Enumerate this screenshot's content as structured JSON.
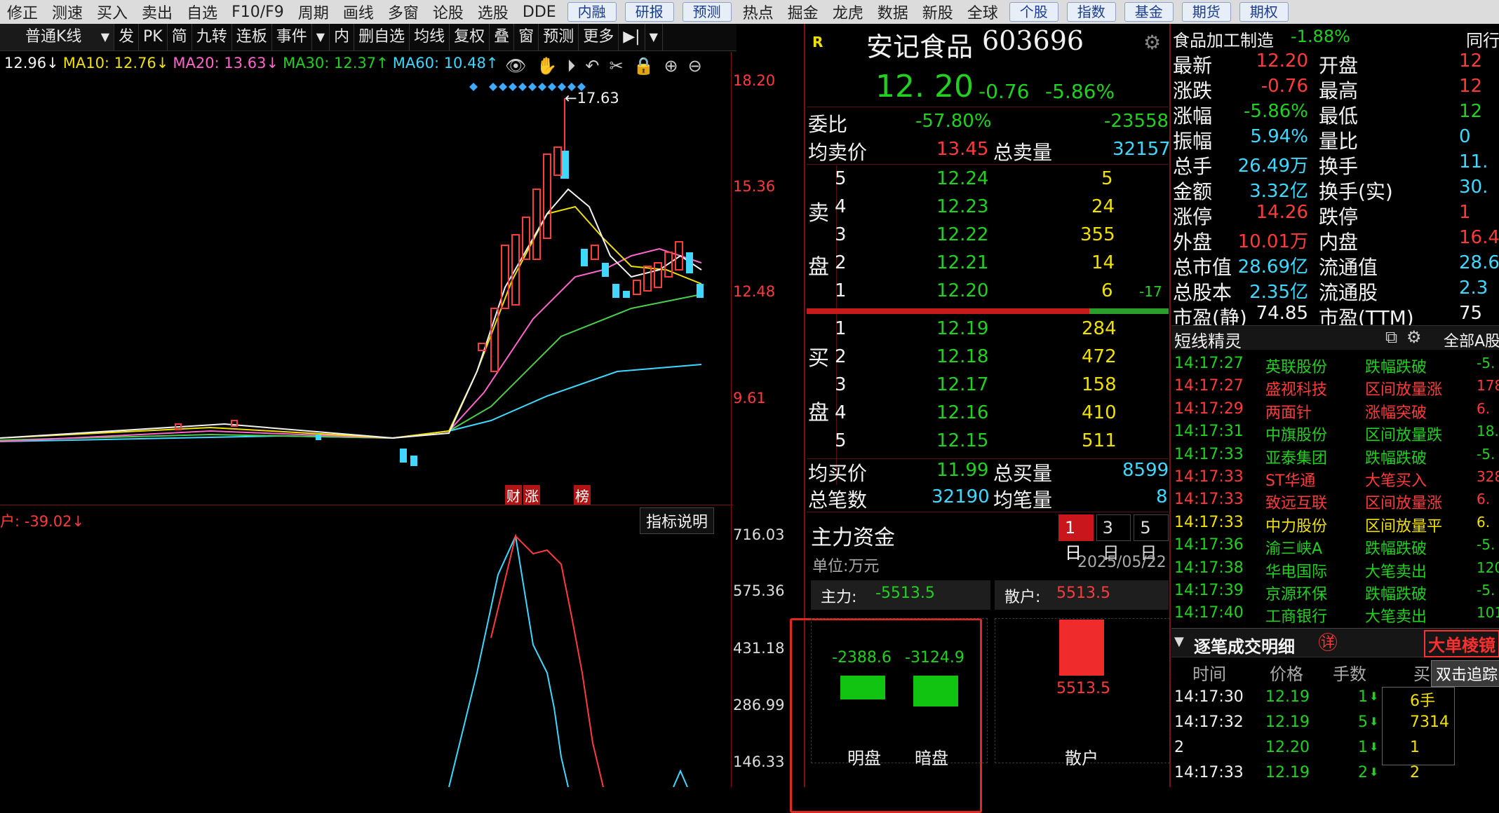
{
  "topbar": {
    "items": [
      "修正",
      "测速",
      "买入",
      "卖出",
      "自选",
      "F10/F9",
      "周期",
      "画线",
      "多窗",
      "论股",
      "选股",
      "DDE"
    ],
    "buttons": [
      "内融",
      "研报",
      "预测"
    ],
    "items2": [
      "热点",
      "掘金",
      "龙虎",
      "数据",
      "新股",
      "全球"
    ],
    "buttons2": [
      "个股",
      "指数",
      "基金",
      "期货",
      "期权"
    ]
  },
  "toolbar": {
    "kline_select": "普通K线",
    "items": [
      "发",
      "PK",
      "简",
      "九转",
      "连板",
      "事件"
    ],
    "items2": [
      "内",
      "删自选",
      "均线",
      "复权",
      "叠",
      "窗",
      "预测",
      "更多"
    ]
  },
  "ma_line": {
    "close": "12.96↓",
    "ma10": "MA10: 12.76↓",
    "ma20": "MA20: 13.63↓",
    "ma30": "MA30: 12.37↑",
    "ma60": "MA60: 10.48↑"
  },
  "kchart": {
    "price_axis": [
      "18.20",
      "15.36",
      "12.48",
      "9.61"
    ],
    "high_marker": "←17.63",
    "tags": [
      "财",
      "涨",
      "榜"
    ]
  },
  "indicator": {
    "title": "户: -39.02↓",
    "help_label": "指标说明",
    "axis": [
      "716.03",
      "575.36",
      "431.18",
      "286.99",
      "146.33"
    ]
  },
  "quote": {
    "badge": "R",
    "name": "安记食品",
    "code": "603696",
    "price": "12. 20",
    "change": "-0.76",
    "change_pct": "-5.86%",
    "weibi_label": "委比",
    "weibi": "-57.80%",
    "weicha": "-23558",
    "avg_sell_label": "均卖价",
    "avg_sell": "13.45",
    "total_sell_label": "总卖量",
    "total_sell": "32157",
    "sell_side_label": [
      "卖",
      "盘"
    ],
    "sells": [
      {
        "lvl": "5",
        "price": "12.24",
        "vol": "5",
        "chg": ""
      },
      {
        "lvl": "4",
        "price": "12.23",
        "vol": "24",
        "chg": ""
      },
      {
        "lvl": "3",
        "price": "12.22",
        "vol": "355",
        "chg": ""
      },
      {
        "lvl": "2",
        "price": "12.21",
        "vol": "14",
        "chg": ""
      },
      {
        "lvl": "1",
        "price": "12.20",
        "vol": "6",
        "chg": "-17"
      }
    ],
    "buy_side_label": [
      "买",
      "盘"
    ],
    "buys": [
      {
        "lvl": "1",
        "price": "12.19",
        "vol": "284"
      },
      {
        "lvl": "2",
        "price": "12.18",
        "vol": "472"
      },
      {
        "lvl": "3",
        "price": "12.17",
        "vol": "158"
      },
      {
        "lvl": "4",
        "price": "12.16",
        "vol": "410"
      },
      {
        "lvl": "5",
        "price": "12.15",
        "vol": "511"
      }
    ],
    "avg_buy_label": "均买价",
    "avg_buy": "11.99",
    "total_buy_label": "总买量",
    "total_buy": "8599",
    "total_trades_label": "总笔数",
    "total_trades": "32190",
    "avg_trade_label": "均笔量",
    "avg_trade": "8"
  },
  "fund": {
    "title": "主力资金",
    "tabs": [
      "1日",
      "3日",
      "5日"
    ],
    "unit": "单位:万元",
    "date": "2025/05/22",
    "main_label": "主力:",
    "main_value": "-5513.5",
    "retail_label": "散户:",
    "retail_value": "5513.5",
    "ming": "-2388.6",
    "an": "-3124.9",
    "retail_bar": "5513.5",
    "ming_label": "明盘",
    "an_label": "暗盘",
    "retail_bar_label": "散户"
  },
  "stats": {
    "industry": "食品加工制造",
    "industry_chg": "-1.88%",
    "tong": "同行",
    "rows": [
      [
        "最新",
        "12.20",
        "开盘",
        "12"
      ],
      [
        "涨跌",
        "-0.76",
        "最高",
        "12"
      ],
      [
        "涨幅",
        "-5.86%",
        "最低",
        "12"
      ],
      [
        "振幅",
        "5.94%",
        "量比",
        "0"
      ],
      [
        "总手",
        "26.49万",
        "换手",
        "11."
      ],
      [
        "金额",
        "3.32亿",
        "换手(实)",
        "30."
      ],
      [
        "涨停",
        "14.26",
        "跌停",
        "1"
      ],
      [
        "外盘",
        "10.01万",
        "内盘",
        "16.4"
      ],
      [
        "总市值",
        "28.69亿",
        "流通值",
        "28.6"
      ],
      [
        "总股本",
        "2.35亿",
        "流通股",
        "2.3"
      ],
      [
        "市盈(静)",
        "74.85",
        "市盈(TTM)",
        "75"
      ]
    ],
    "row_colors": [
      "red",
      "red",
      "green",
      "cyan",
      "cyan",
      "cyan",
      "red",
      "red",
      "cyan",
      "cyan",
      "white"
    ]
  },
  "sprite": {
    "title": "短线精灵",
    "scope": "全部A股",
    "items": [
      {
        "time": "14:17:27",
        "name": "英联股份",
        "event": "跌幅跌破",
        "val": "-5.",
        "c": "green"
      },
      {
        "time": "14:17:27",
        "name": "盛视科技",
        "event": "区间放量涨",
        "val": "178.",
        "c": "red"
      },
      {
        "time": "14:17:29",
        "name": "两面针",
        "event": "涨幅突破",
        "val": "6.",
        "c": "red"
      },
      {
        "time": "14:17:31",
        "name": "中旗股份",
        "event": "区间放量跌",
        "val": "18.",
        "c": "green"
      },
      {
        "time": "14:17:33",
        "name": "亚泰集团",
        "event": "跌幅跌破",
        "val": "-5.",
        "c": "green"
      },
      {
        "time": "14:17:33",
        "name": "ST华通",
        "event": "大笔买入",
        "val": "328",
        "c": "red"
      },
      {
        "time": "14:17:33",
        "name": "致远互联",
        "event": "区间放量涨",
        "val": "6.",
        "c": "red"
      },
      {
        "time": "14:17:33",
        "name": "中力股份",
        "event": "区间放量平",
        "val": "6.",
        "c": "yellow"
      },
      {
        "time": "14:17:36",
        "name": "渝三峡A",
        "event": "跌幅跌破",
        "val": "-5.",
        "c": "green"
      },
      {
        "time": "14:17:38",
        "name": "华电国际",
        "event": "大笔卖出",
        "val": "120",
        "c": "green"
      },
      {
        "time": "14:17:39",
        "name": "京源环保",
        "event": "跌幅跌破",
        "val": "-5.",
        "c": "green"
      },
      {
        "time": "14:17:40",
        "name": "工商银行",
        "event": "大笔卖出",
        "val": "101",
        "c": "green"
      }
    ]
  },
  "trades": {
    "title": "逐笔成交明细",
    "detail_icon": "详",
    "big_label": "大单棱镜",
    "tooltip": "双击追踪",
    "headers": [
      "时间",
      "价格",
      "手数",
      "买"
    ],
    "rows": [
      {
        "time": "14:17:30",
        "price": "12.19",
        "lots": "1",
        "side": "6手"
      },
      {
        "time": "14:17:32",
        "price": "12.19",
        "lots": "5",
        "side": "7314"
      },
      {
        "time": "2",
        "price": "12.20",
        "lots": "1",
        "side": "1"
      },
      {
        "time": "14:17:33",
        "price": "12.19",
        "lots": "2",
        "side": "2"
      }
    ]
  }
}
